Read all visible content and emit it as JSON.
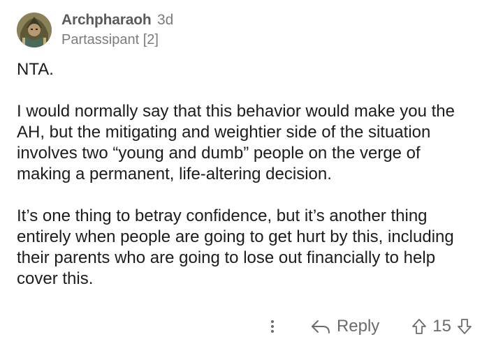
{
  "comment": {
    "author": "Archpharaoh",
    "age": "3d",
    "flair": "Partassipant [2]",
    "avatar_icon": "user-avatar",
    "paragraphs": [
      "NTA.",
      "I would normally say that this behavior would make you the AH, but the mitigating and weightier side of the situation involves two “young and dumb” people on the verge of making a permanent, life-altering decision.",
      "It’s one thing to betray confidence, but it’s another thing entirely when people are going to get hurt by this, including their parents who are going to lose out financially to help cover this."
    ]
  },
  "actions": {
    "more_icon": "more-vertical-icon",
    "reply_icon": "reply-arrow-icon",
    "reply_label": "Reply",
    "upvote_icon": "arrow-up-icon",
    "downvote_icon": "arrow-down-icon",
    "score": "15"
  },
  "colors": {
    "text": "#1c1c1c",
    "meta": "#7c7c7c",
    "icon": "#6b6b6b"
  }
}
